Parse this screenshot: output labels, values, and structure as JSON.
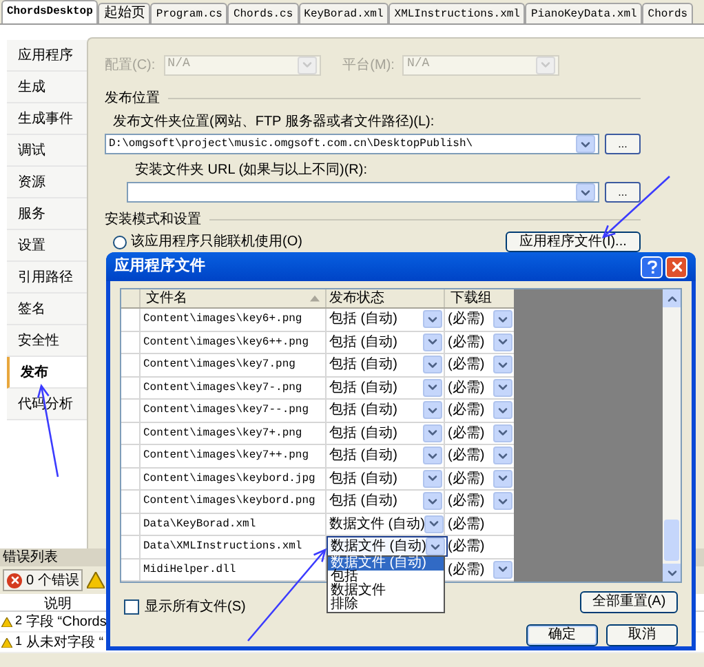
{
  "tabs": [
    {
      "label": "ChordsDesktop",
      "selected": true
    },
    {
      "label": "起始页",
      "selected": false
    },
    {
      "label": "Program.cs",
      "selected": false
    },
    {
      "label": "Chords.cs",
      "selected": false
    },
    {
      "label": "KeyBorad.xml",
      "selected": false
    },
    {
      "label": "XMLInstructions.xml",
      "selected": false
    },
    {
      "label": "PianoKeyData.xml",
      "selected": false
    },
    {
      "label": "Chords",
      "selected": false
    }
  ],
  "sidebar": {
    "items": [
      {
        "label": "应用程序",
        "selected": false
      },
      {
        "label": "生成",
        "selected": false
      },
      {
        "label": "生成事件",
        "selected": false
      },
      {
        "label": "调试",
        "selected": false
      },
      {
        "label": "资源",
        "selected": false
      },
      {
        "label": "服务",
        "selected": false
      },
      {
        "label": "设置",
        "selected": false
      },
      {
        "label": "引用路径",
        "selected": false
      },
      {
        "label": "签名",
        "selected": false
      },
      {
        "label": "安全性",
        "selected": false
      },
      {
        "label": "发布",
        "selected": true
      },
      {
        "label": "代码分析",
        "selected": false
      }
    ]
  },
  "config": {
    "disabled": true,
    "configuration_label": "配置(C):",
    "configuration_value": "N/A",
    "platform_label": "平台(M):",
    "platform_value": "N/A"
  },
  "publish_location": {
    "heading": "发布位置",
    "folder_label": "发布文件夹位置(网站、FTP 服务器或者文件路径)(L):",
    "folder_value": "D:\\omgsoft\\project\\music.omgsoft.com.cn\\DesktopPublish\\",
    "folder_browse": "...",
    "url_label": "安装文件夹 URL (如果与以上不同)(R):",
    "url_browse": "..."
  },
  "install_mode": {
    "heading": "安装模式和设置",
    "online_only": {
      "label": "该应用程序只能联机使用(O)",
      "checked": false
    },
    "app_files_button": "应用程序文件(I)..."
  },
  "dialog": {
    "title": "应用程序文件",
    "columns": [
      "文件名",
      "发布状态",
      "下载组"
    ],
    "rows": [
      {
        "name": "Content\\images\\key6+.png",
        "status": "包括 (自动)",
        "group": "(必需)",
        "status_dropdown": true,
        "group_dropdown": true,
        "editing": false
      },
      {
        "name": "Content\\images\\key6++.png",
        "status": "包括 (自动)",
        "group": "(必需)",
        "status_dropdown": true,
        "group_dropdown": true,
        "editing": false
      },
      {
        "name": "Content\\images\\key7.png",
        "status": "包括 (自动)",
        "group": "(必需)",
        "status_dropdown": true,
        "group_dropdown": true,
        "editing": false
      },
      {
        "name": "Content\\images\\key7-.png",
        "status": "包括 (自动)",
        "group": "(必需)",
        "status_dropdown": true,
        "group_dropdown": true,
        "editing": false
      },
      {
        "name": "Content\\images\\key7--.png",
        "status": "包括 (自动)",
        "group": "(必需)",
        "status_dropdown": true,
        "group_dropdown": true,
        "editing": false
      },
      {
        "name": "Content\\images\\key7+.png",
        "status": "包括 (自动)",
        "group": "(必需)",
        "status_dropdown": true,
        "group_dropdown": true,
        "editing": false
      },
      {
        "name": "Content\\images\\key7++.png",
        "status": "包括 (自动)",
        "group": "(必需)",
        "status_dropdown": true,
        "group_dropdown": true,
        "editing": false
      },
      {
        "name": "Content\\images\\keybord.jpg",
        "status": "包括 (自动)",
        "group": "(必需)",
        "status_dropdown": true,
        "group_dropdown": true,
        "editing": false
      },
      {
        "name": "Content\\images\\keybord.png",
        "status": "包括 (自动)",
        "group": "(必需)",
        "status_dropdown": true,
        "group_dropdown": true,
        "editing": false
      },
      {
        "name": "Data\\KeyBorad.xml",
        "status": "数据文件 (自动)",
        "group": "(必需)",
        "status_dropdown": true,
        "group_dropdown": false,
        "editing": false
      },
      {
        "name": "Data\\XMLInstructions.xml",
        "status": "数据文件 (自动)",
        "group": "(必需)",
        "status_dropdown": true,
        "group_dropdown": false,
        "editing": true
      },
      {
        "name": "MidiHelper.dll",
        "group": "(必需)",
        "group_dropdown": true
      }
    ],
    "dropdown": {
      "options": [
        {
          "label": "数据文件 (自动)",
          "selected": true
        },
        {
          "label": "包括",
          "selected": false
        },
        {
          "label": "数据文件",
          "selected": false
        },
        {
          "label": "排除",
          "selected": false
        }
      ]
    },
    "show_all": {
      "label": "显示所有文件(S)",
      "checked": false
    },
    "reset_button": "全部重置(A)",
    "ok_button": "确定",
    "cancel_button": "取消"
  },
  "error_list": {
    "title": "错误列表",
    "errors_button": "0 个错误",
    "column": "说明",
    "rows": [
      {
        "number": "2",
        "text": "字段 “Chords"
      },
      {
        "number": "1",
        "text": "从未对字段 “"
      }
    ]
  }
}
